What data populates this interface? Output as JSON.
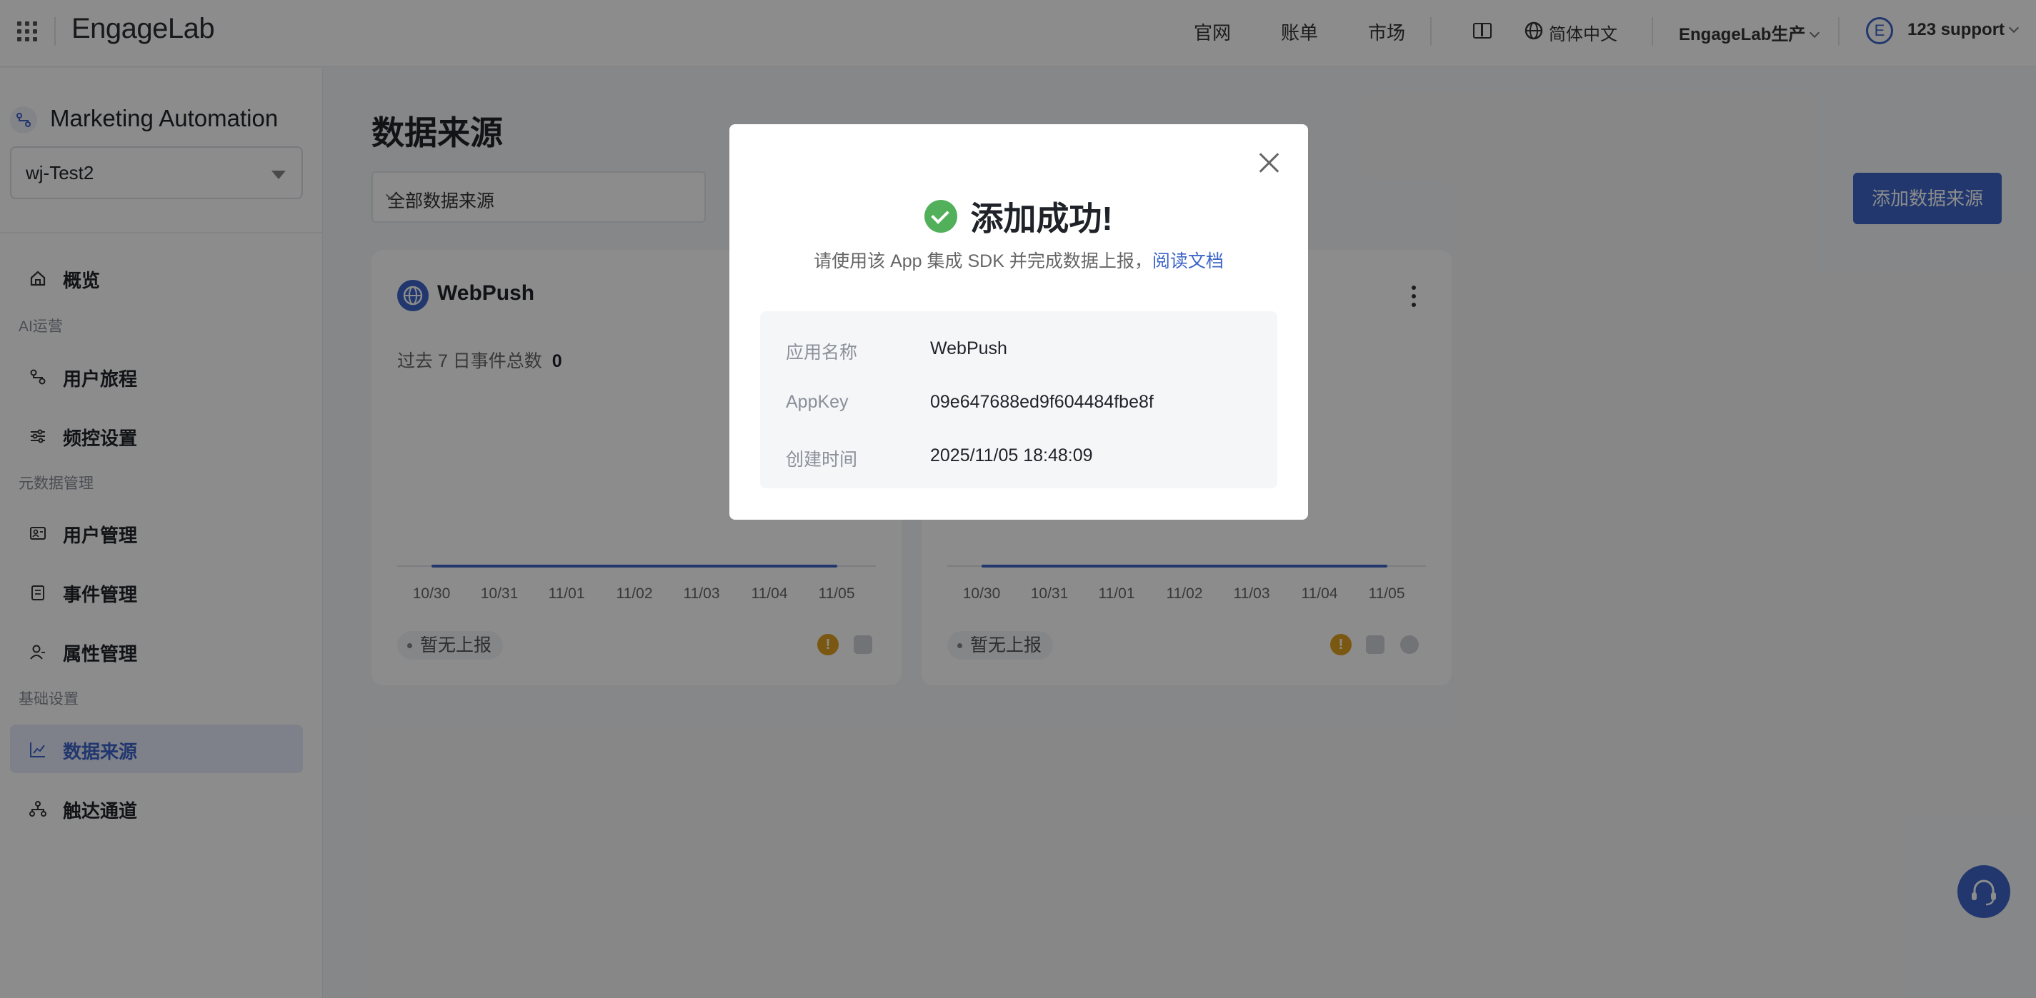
{
  "topbar": {
    "logo": "EngageLab",
    "links": [
      "官网",
      "账单",
      "市场"
    ],
    "language": "简体中文",
    "environment": "EngageLab生产",
    "avatar_initial": "E",
    "user": "123 support"
  },
  "sidebar": {
    "product_title": "Marketing Automation",
    "app_selected": "wj-Test2",
    "groups": {
      "ai": "AI运营",
      "metadata": "元数据管理",
      "basic": "基础设置"
    },
    "items": [
      {
        "label": "概览",
        "icon": "home-icon"
      },
      {
        "label": "用户旅程",
        "icon": "journey-icon"
      },
      {
        "label": "频控设置",
        "icon": "sliders-icon"
      },
      {
        "label": "用户管理",
        "icon": "user-card-icon"
      },
      {
        "label": "事件管理",
        "icon": "clipboard-icon"
      },
      {
        "label": "属性管理",
        "icon": "user-icon"
      },
      {
        "label": "数据来源",
        "icon": "chart-line-icon",
        "active": true
      },
      {
        "label": "触达通道",
        "icon": "network-icon"
      }
    ]
  },
  "main": {
    "title": "数据来源",
    "filter": "全部数据来源",
    "add_button": "添加数据来源",
    "cards": [
      {
        "name": "WebPush",
        "metric_label": "过去 7 日事件总数",
        "metric_value": "0",
        "ticks": [
          "10/30",
          "10/31",
          "11/01",
          "11/02",
          "11/03",
          "11/04",
          "11/05"
        ],
        "status": "暂无上报"
      },
      {
        "name": "",
        "ticks": [
          "10/30",
          "10/31",
          "11/01",
          "11/02",
          "11/03",
          "11/04",
          "11/05"
        ],
        "status": "暂无上报"
      }
    ]
  },
  "modal": {
    "title": "添加成功!",
    "hint": "请使用该 App 集成 SDK 并完成数据上报，",
    "doc_link": "阅读文档",
    "rows": [
      {
        "key": "应用名称",
        "value": "WebPush"
      },
      {
        "key": "AppKey",
        "value": "09e647688ed9f604484fbe8f"
      },
      {
        "key": "创建时间",
        "value": "2025/11/05 18:48:09"
      }
    ]
  },
  "colors": {
    "accent": "#3c64c8",
    "success": "#52b05a",
    "warning": "#e0a020"
  }
}
